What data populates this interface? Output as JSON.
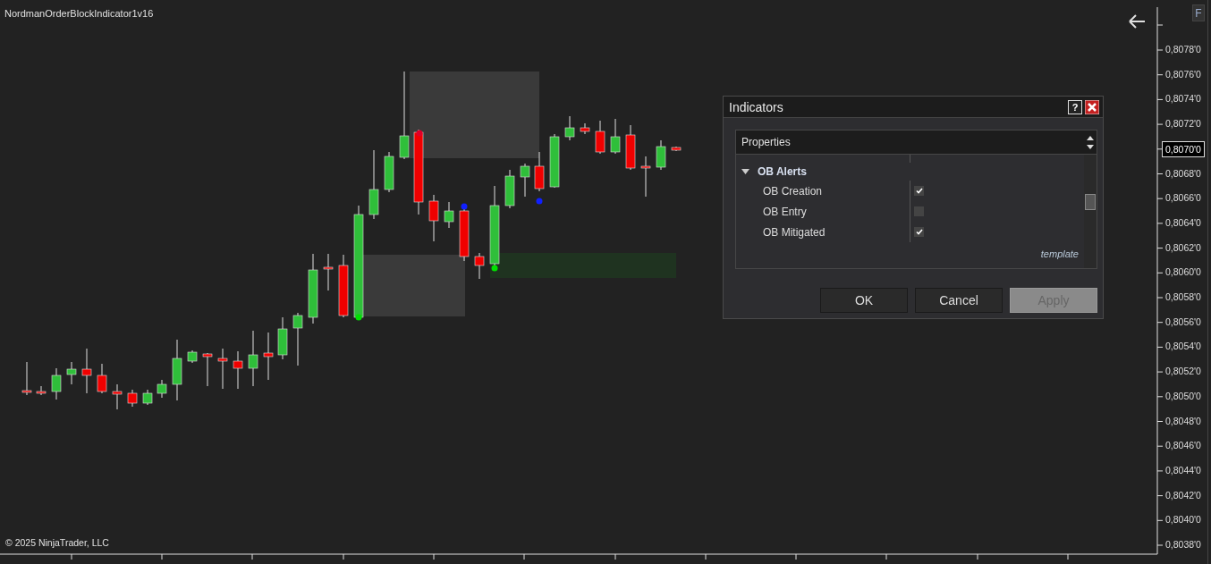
{
  "chart": {
    "title": "NordmanOrderBlockIndicator1v16",
    "copyright": "© 2025 NinjaTrader, LLC",
    "price_axis": [
      {
        "label": "0,8078'0",
        "current": false
      },
      {
        "label": "0,8076'0",
        "current": false
      },
      {
        "label": "0,8074'0",
        "current": false
      },
      {
        "label": "0,8072'0",
        "current": false
      },
      {
        "label": "0,8070'0",
        "current": true
      },
      {
        "label": "0,8068'0",
        "current": false
      },
      {
        "label": "0,8066'0",
        "current": false
      },
      {
        "label": "0,8064'0",
        "current": false
      },
      {
        "label": "0,8062'0",
        "current": false
      },
      {
        "label": "0,8060'0",
        "current": false
      },
      {
        "label": "0,8058'0",
        "current": false
      },
      {
        "label": "0,8056'0",
        "current": false
      },
      {
        "label": "0,8054'0",
        "current": false
      },
      {
        "label": "0,8052'0",
        "current": false
      },
      {
        "label": "0,8050'0",
        "current": false
      },
      {
        "label": "0,8048'0",
        "current": false
      },
      {
        "label": "0,8046'0",
        "current": false
      },
      {
        "label": "0,8044'0",
        "current": false
      },
      {
        "label": "0,8042'0",
        "current": false
      },
      {
        "label": "0,8040'0",
        "current": false
      },
      {
        "label": "0,8038'0",
        "current": false
      }
    ],
    "f_button": "F"
  },
  "dialog": {
    "title": "Indicators",
    "help": "?",
    "header": "Properties",
    "group": {
      "label": "OB Alerts",
      "expanded": true
    },
    "rows": [
      {
        "label": "OB Creation",
        "checked": true
      },
      {
        "label": "OB Entry",
        "checked": false
      },
      {
        "label": "OB Mitigated",
        "checked": true
      }
    ],
    "footer": "template",
    "buttons": [
      {
        "label": "OK",
        "disabled": false
      },
      {
        "label": "Cancel",
        "disabled": false
      },
      {
        "label": "Apply",
        "disabled": true
      }
    ]
  }
}
